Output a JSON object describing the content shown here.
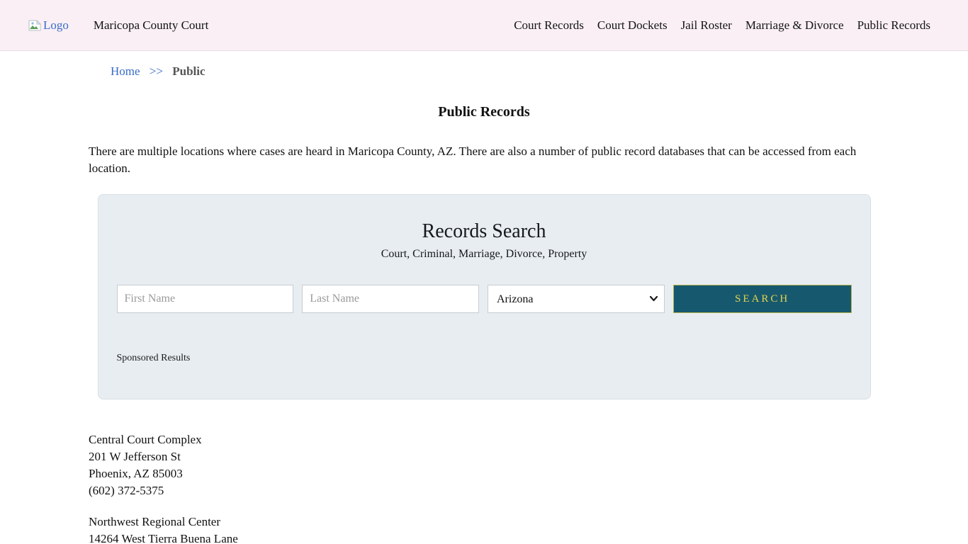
{
  "header": {
    "logo_alt": "Logo",
    "title": "Maricopa County Court",
    "nav": [
      {
        "label": "Court Records"
      },
      {
        "label": "Court Dockets"
      },
      {
        "label": "Jail Roster"
      },
      {
        "label": "Marriage & Divorce"
      },
      {
        "label": "Public Records"
      }
    ]
  },
  "breadcrumb": {
    "home": "Home",
    "separator": ">>",
    "current": "Public"
  },
  "page": {
    "title": "Public Records",
    "intro": "There are multiple locations where cases are heard in Maricopa County, AZ. There are also a number of public record databases that can be accessed from each location."
  },
  "search": {
    "title": "Records Search",
    "subtitle": "Court, Criminal, Marriage, Divorce, Property",
    "first_name_placeholder": "First Name",
    "last_name_placeholder": "Last Name",
    "state_selected": "Arizona",
    "button_label": "SEARCH",
    "sponsored_label": "Sponsored Results"
  },
  "locations": [
    {
      "lines": {
        "0": "Central Court Complex",
        "1": "201 W Jefferson St",
        "2": "Phoenix, AZ 85003",
        "3": "(602) 372-5375"
      }
    },
    {
      "lines": {
        "0": "Northwest Regional Center",
        "1": "14264 West Tierra Buena Lane"
      }
    }
  ],
  "colors": {
    "header_bg": "#f9eff5",
    "panel_bg": "#e8edf2",
    "button_bg": "#16596f",
    "button_text": "#e6d34c",
    "link_blue": "#3a6bc7"
  }
}
